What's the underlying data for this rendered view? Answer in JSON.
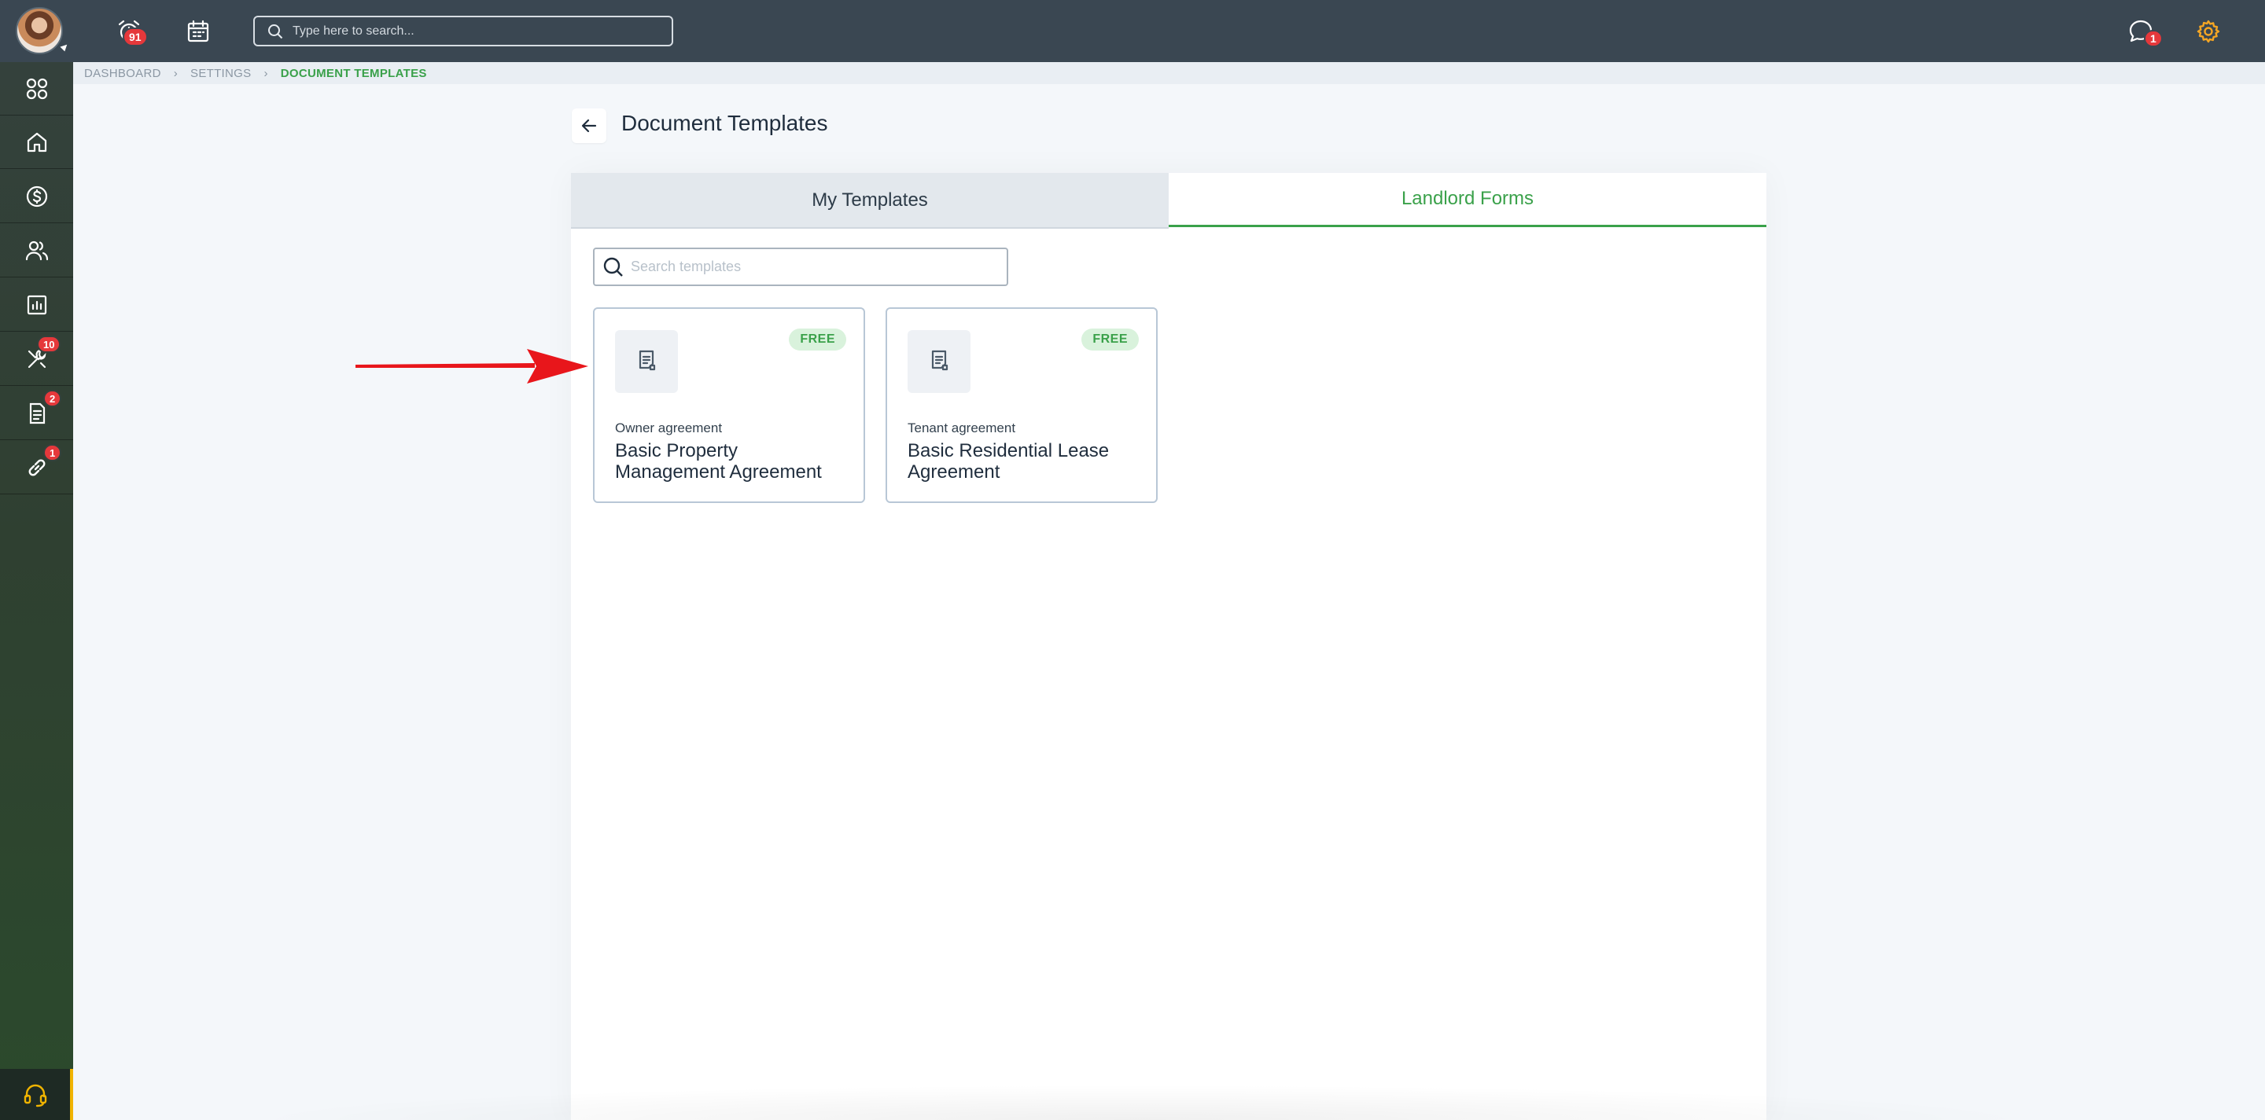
{
  "topbar": {
    "notifications_badge": "91",
    "search_placeholder": "Type here to search...",
    "messages_badge": "1"
  },
  "sidebar": {
    "items": [
      {
        "name": "apps",
        "icon": "apps-grid-icon",
        "badge": ""
      },
      {
        "name": "home",
        "icon": "home-icon",
        "badge": ""
      },
      {
        "name": "finance",
        "icon": "dollar-circle-icon",
        "badge": ""
      },
      {
        "name": "people",
        "icon": "users-icon",
        "badge": ""
      },
      {
        "name": "reports",
        "icon": "bar-chart-icon",
        "badge": ""
      },
      {
        "name": "maintenance",
        "icon": "tools-icon",
        "badge": "10"
      },
      {
        "name": "documents",
        "icon": "document-icon",
        "badge": "2"
      },
      {
        "name": "integrations",
        "icon": "link-icon",
        "badge": "1"
      }
    ]
  },
  "breadcrumb": {
    "items": [
      "DASHBOARD",
      "SETTINGS",
      "DOCUMENT TEMPLATES"
    ]
  },
  "page": {
    "title": "Document Templates"
  },
  "tabs": [
    {
      "label": "My Templates",
      "active": false
    },
    {
      "label": "Landlord Forms",
      "active": true
    }
  ],
  "templates_search": {
    "placeholder": "Search templates"
  },
  "cards": [
    {
      "badge": "FREE",
      "type": "Owner agreement",
      "name": "Basic Property Management Agreement"
    },
    {
      "badge": "FREE",
      "type": "Tenant agreement",
      "name": "Basic Residential Lease Agreement"
    }
  ],
  "colors": {
    "topbar": "#3a4752",
    "accent_green": "#3aa14a",
    "badge_red": "#e5383b",
    "settings_orange": "#f5a623",
    "annotation_arrow": "#e8161b"
  }
}
